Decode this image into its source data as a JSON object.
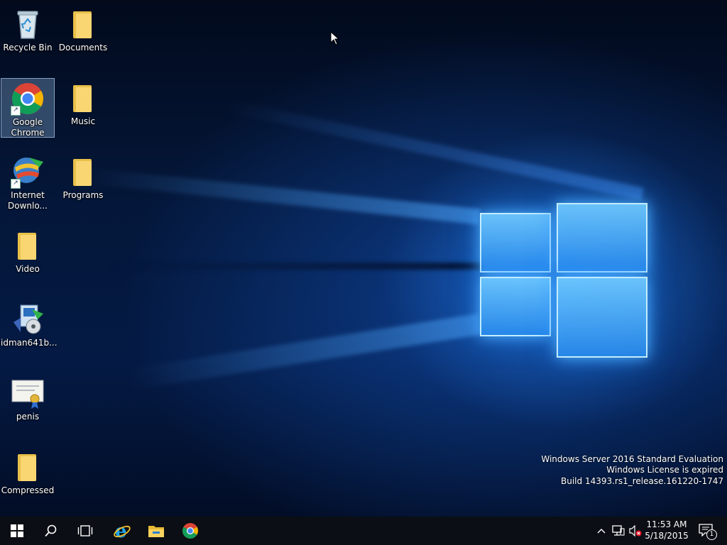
{
  "desktop": {
    "icons": [
      {
        "label": "Recycle Bin",
        "icon": "recycle-bin-icon"
      },
      {
        "label": "Documents",
        "icon": "folder-icon"
      },
      {
        "label": "Google Chrome",
        "icon": "chrome-icon",
        "selected": true
      },
      {
        "label": "Music",
        "icon": "folder-icon"
      },
      {
        "label": "Internet Downlo...",
        "icon": "internet-download-manager-icon"
      },
      {
        "label": "Programs",
        "icon": "folder-icon"
      },
      {
        "label": "Video",
        "icon": "folder-icon"
      },
      {
        "label": "idman641b...",
        "icon": "installer-icon"
      },
      {
        "label": "penis",
        "icon": "certificate-icon"
      },
      {
        "label": "Compressed",
        "icon": "folder-icon"
      }
    ],
    "watermark": {
      "line1": "Windows Server 2016 Standard Evaluation",
      "line2": "Windows License is expired",
      "line3": "Build 14393.rs1_release.161220-1747"
    }
  },
  "taskbar": {
    "start": "windows-start-icon",
    "search": "search-icon",
    "task_view": "task-view-icon",
    "pinned": [
      "internet-explorer-icon",
      "file-explorer-icon",
      "chrome-icon"
    ],
    "tray": [
      "chevron-up-icon",
      "network-icon",
      "volume-muted-icon"
    ],
    "clock": {
      "time": "11:53 AM",
      "date": "5/18/2015"
    },
    "notifications": {
      "icon": "action-center-icon",
      "count": "1"
    }
  },
  "colors": {
    "taskbar": "#0b0e14",
    "accent_blue": "#1e78e6",
    "folder": "#f9d672"
  }
}
